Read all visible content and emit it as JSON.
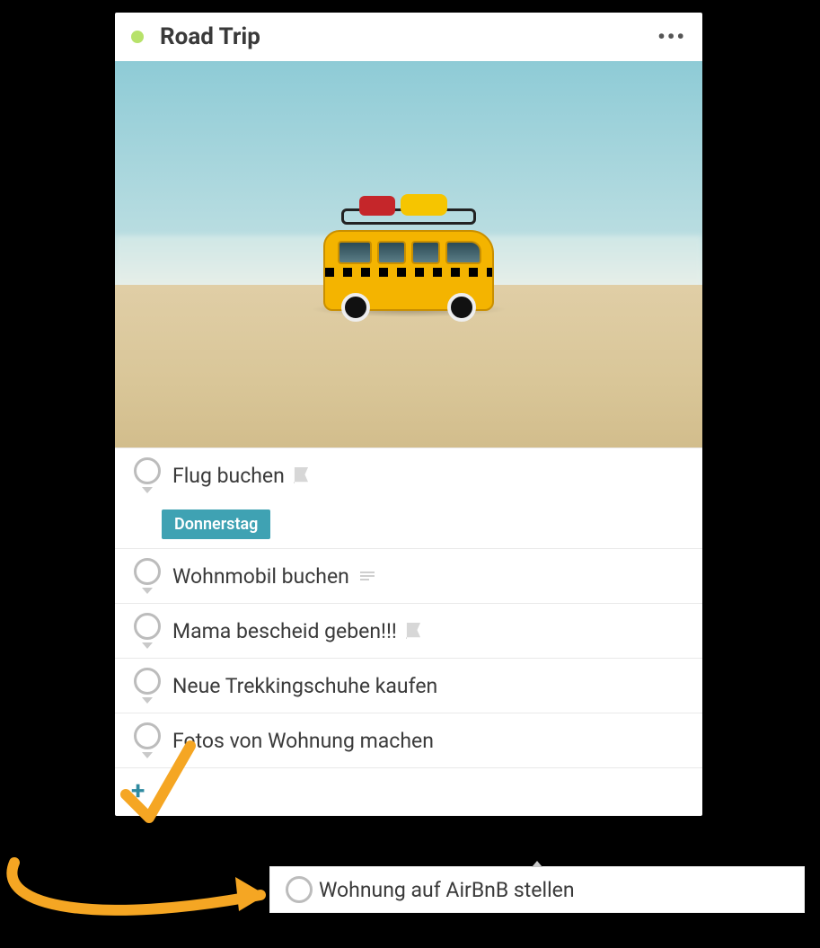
{
  "header": {
    "title": "Road Trip",
    "more_label": "•••",
    "status_color": "#b7e26a"
  },
  "cover": {
    "alt": "Toy yellow bus on a sandy beach"
  },
  "tasks": [
    {
      "label": "Flug buchen",
      "flag": true,
      "badge": "Donnerstag"
    },
    {
      "label": "Wohnmobil buchen",
      "has_note": true
    },
    {
      "label": "Mama bescheid geben!!!",
      "flag": true
    },
    {
      "label": "Neue Trekkingschuhe kaufen"
    },
    {
      "label": "Fotos von Wohnung machen"
    }
  ],
  "add_button": "+",
  "dragged_task": {
    "label": "Wohnung auf AirBnB stellen"
  },
  "colors": {
    "accent": "#3fa2b3",
    "annotation": "#f5a623"
  }
}
